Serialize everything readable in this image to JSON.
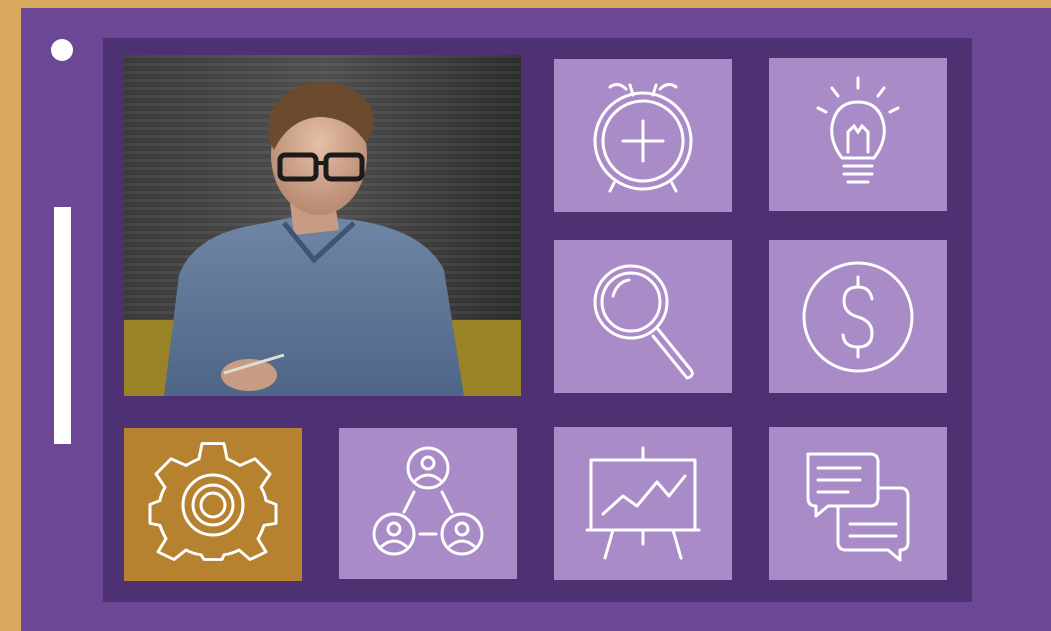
{
  "colors": {
    "frame": "#d8a95f",
    "panel": "#6b4796",
    "grid_bg": "#4d3173",
    "tile": "#a98bc8",
    "tile_accent": "#b6822f",
    "icon_stroke": "#ffffff",
    "dot": "#ffffff"
  },
  "photo": {
    "icon": "portrait-photo-man-with-glasses-writing"
  },
  "tiles": [
    {
      "icon": "alarm-clock-icon"
    },
    {
      "icon": "lightbulb-icon"
    },
    {
      "icon": "magnifying-glass-icon"
    },
    {
      "icon": "dollar-coin-icon"
    },
    {
      "icon": "gear-icon",
      "selected": true
    },
    {
      "icon": "team-network-icon"
    },
    {
      "icon": "chart-easel-icon"
    },
    {
      "icon": "chat-bubbles-icon"
    }
  ]
}
